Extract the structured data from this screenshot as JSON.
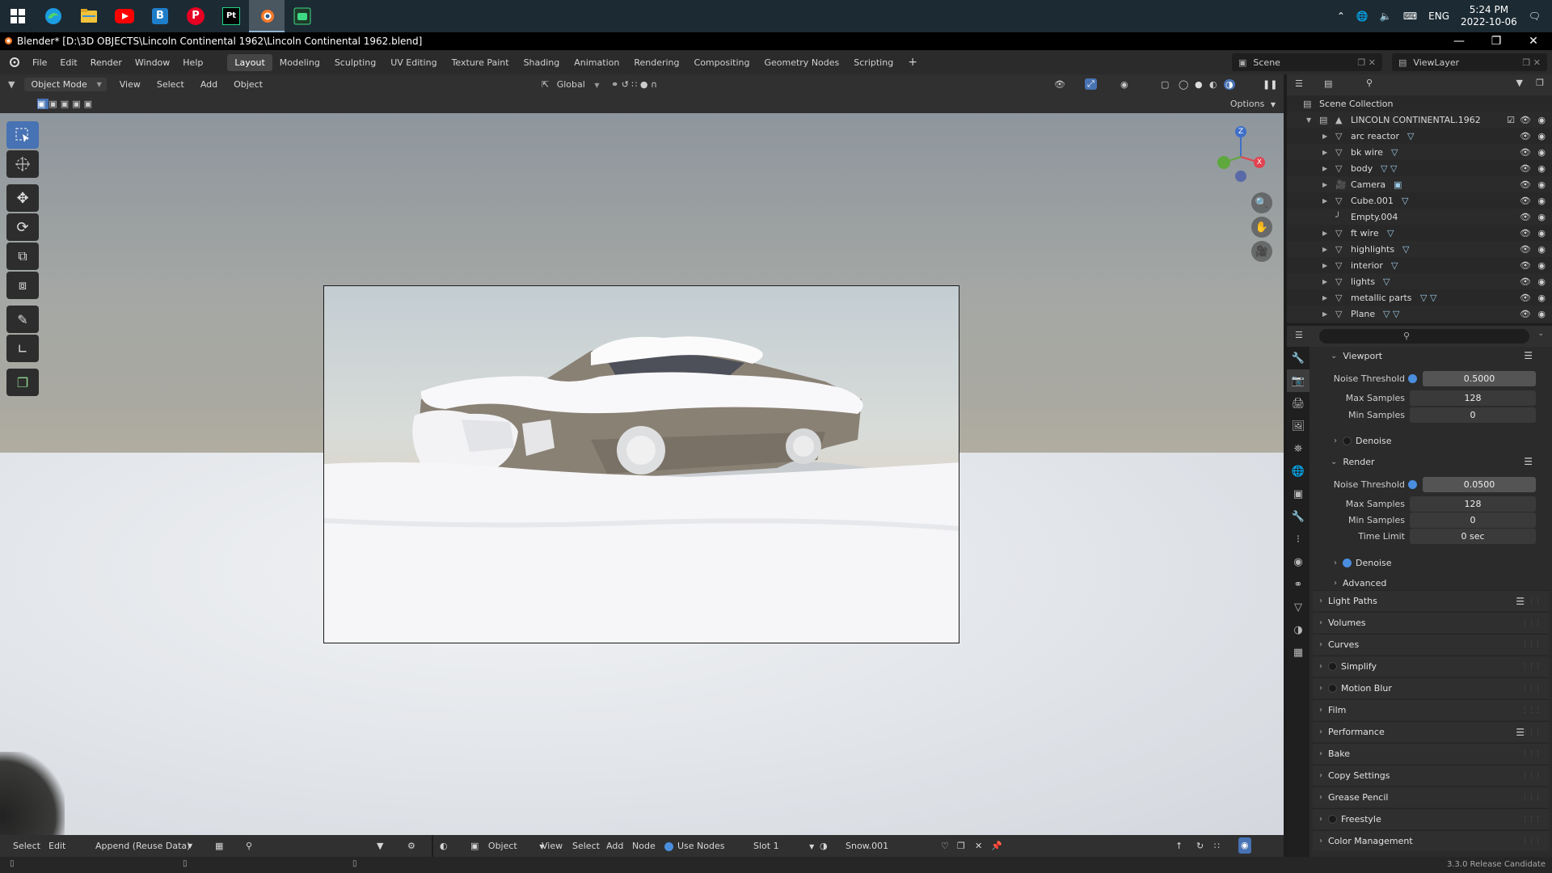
{
  "taskbar": {
    "apps": [
      {
        "name": "windows-start-icon"
      },
      {
        "name": "edge-icon"
      },
      {
        "name": "file-explorer-icon"
      },
      {
        "name": "youtube-icon"
      },
      {
        "name": "app-b-icon",
        "label": "B"
      },
      {
        "name": "pinterest-icon",
        "label": "P"
      },
      {
        "name": "pycharm-icon",
        "label": "Pt"
      },
      {
        "name": "blender-icon"
      },
      {
        "name": "android-app-icon"
      }
    ],
    "language": "ENG",
    "time": "5:24 PM",
    "date": "2022-10-06"
  },
  "window": {
    "title": "Blender* [D:\\3D OBJECTS\\Lincoln Continental 1962\\Lincoln Continental 1962.blend]"
  },
  "topbar": {
    "menus": [
      "File",
      "Edit",
      "Render",
      "Window",
      "Help"
    ],
    "workspaces": [
      "Layout",
      "Modeling",
      "Sculpting",
      "UV Editing",
      "Texture Paint",
      "Shading",
      "Animation",
      "Rendering",
      "Compositing",
      "Geometry Nodes",
      "Scripting"
    ],
    "active_workspace": "Layout",
    "add_tab": "+",
    "scene": "Scene",
    "view_layer": "ViewLayer"
  },
  "viewport": {
    "mode": "Object Mode",
    "menus": [
      "View",
      "Select",
      "Add",
      "Object"
    ],
    "orientation": "Global",
    "options": "Options"
  },
  "gizmo": {
    "z": "Z",
    "x": "X",
    "y": "Y"
  },
  "outliner": {
    "root": "Scene Collection",
    "collection": "LINCOLN CONTINENTAL.1962",
    "items": [
      {
        "label": "arc reactor",
        "icon": "mesh-icon",
        "mods": "▽"
      },
      {
        "label": "bk wire",
        "icon": "mesh-icon",
        "mods": "▽"
      },
      {
        "label": "body",
        "icon": "mesh-icon",
        "mods": "▽ ▽"
      },
      {
        "label": "Camera",
        "icon": "camera-icon",
        "mods": "▣"
      },
      {
        "label": "Cube.001",
        "icon": "mesh-icon",
        "mods": "▽"
      },
      {
        "label": "Empty.004",
        "icon": "empty-icon",
        "mods": ""
      },
      {
        "label": "ft wire",
        "icon": "mesh-icon",
        "mods": "▽"
      },
      {
        "label": "highlights",
        "icon": "mesh-icon",
        "mods": "▽"
      },
      {
        "label": "interior",
        "icon": "mesh-icon",
        "mods": "▽"
      },
      {
        "label": "lights",
        "icon": "mesh-icon",
        "mods": "▽"
      },
      {
        "label": "metallic parts",
        "icon": "mesh-icon",
        "mods": "▽ ▽"
      },
      {
        "label": "Plane",
        "icon": "mesh-icon",
        "mods": "▽ ▽"
      }
    ]
  },
  "properties": {
    "viewport_section": "Viewport",
    "viewport_noise_threshold_label": "Noise Threshold",
    "viewport_noise_threshold": "0.5000",
    "viewport_max_samples_label": "Max Samples",
    "viewport_max_samples": "128",
    "viewport_min_samples_label": "Min Samples",
    "viewport_min_samples": "0",
    "viewport_denoise": "Denoise",
    "render_section": "Render",
    "render_noise_threshold_label": "Noise Threshold",
    "render_noise_threshold": "0.0500",
    "render_max_samples_label": "Max Samples",
    "render_max_samples": "128",
    "render_min_samples_label": "Min Samples",
    "render_min_samples": "0",
    "render_time_limit_label": "Time Limit",
    "render_time_limit": "0 sec",
    "render_denoise": "Denoise",
    "advanced": "Advanced",
    "panels": [
      "Light Paths",
      "Volumes",
      "Curves",
      "Simplify",
      "Motion Blur",
      "Film",
      "Performance",
      "Bake",
      "Copy Settings",
      "Grease Pencil",
      "Freestyle",
      "Color Management"
    ]
  },
  "bottom": {
    "select": "Select",
    "edit": "Edit",
    "append": "Append (Reuse Data)",
    "object": "Object",
    "view": "View",
    "select2": "Select",
    "add": "Add",
    "node": "Node",
    "use_nodes": "Use Nodes",
    "slot": "Slot 1",
    "material": "Snow.001"
  },
  "status": {
    "version": "3.3.0 Release Candidate"
  },
  "colors": {
    "accent": "#4772b3",
    "toggle_blue": "#4a8ee0",
    "gizmo_x": "#e0434f",
    "gizmo_y": "#5fa83d",
    "gizmo_z": "#3f6fc8"
  }
}
